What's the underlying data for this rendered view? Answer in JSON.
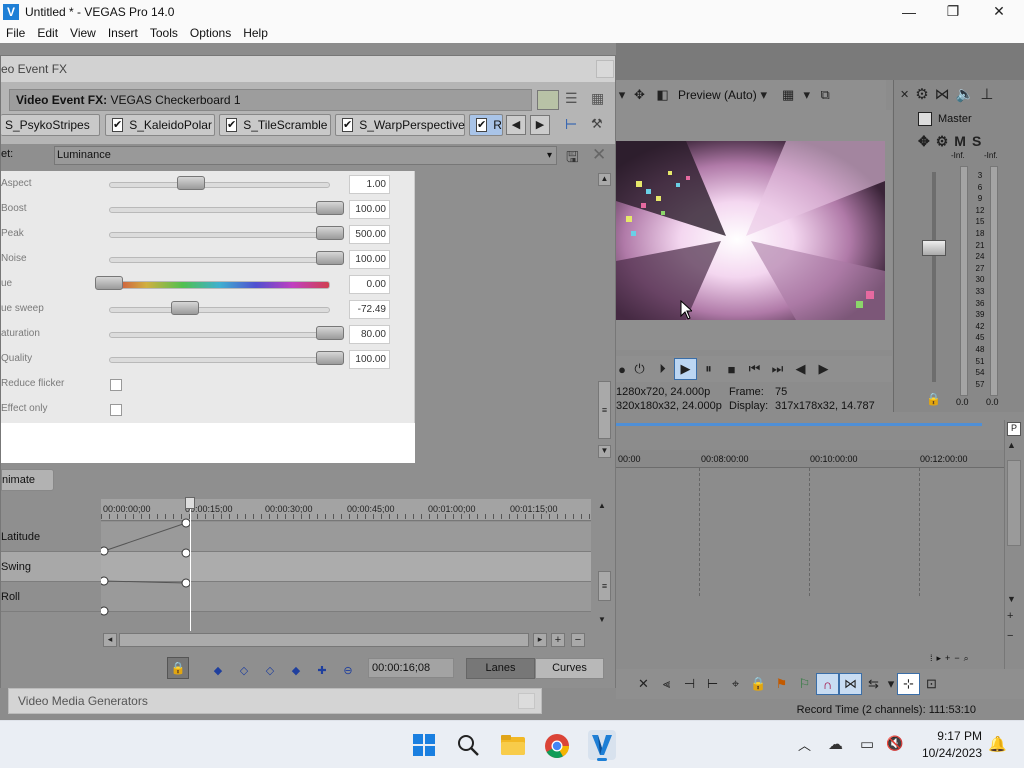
{
  "window": {
    "title": "Untitled * - VEGAS Pro 14.0",
    "logo_letter": "V"
  },
  "window_controls": {
    "minimize": "—",
    "maximize": "❐",
    "close": "✕"
  },
  "menu": [
    "File",
    "Edit",
    "View",
    "Insert",
    "Tools",
    "Options",
    "Help"
  ],
  "fx_dialog": {
    "title": "eo Event FX",
    "header_label": "Video Event FX:",
    "header_value": "VEGAS Checkerboard 1",
    "chain": [
      {
        "label": "S_PsykoStripes",
        "checked": true
      },
      {
        "label": "S_KaleidoPolar",
        "checked": true
      },
      {
        "label": "S_TileScramble",
        "checked": true
      },
      {
        "label": "S_WarpPerspective",
        "checked": true
      },
      {
        "label": "R",
        "checked": true
      }
    ],
    "preset_label": "et:",
    "preset_value": "Luminance",
    "params": [
      {
        "label": "Aspect",
        "value": "1.00",
        "level": 0.33
      },
      {
        "label": "Boost",
        "value": "100.00",
        "level": 1.0
      },
      {
        "label": "Peak",
        "value": "500.00",
        "level": 1.0
      },
      {
        "label": "Noise",
        "value": "100.00",
        "level": 1.0
      },
      {
        "label": "ue",
        "value": "0.00",
        "level": 0.0
      },
      {
        "label": "ue sweep",
        "value": "-72.49",
        "level": 0.3
      },
      {
        "label": "aturation",
        "value": "80.00",
        "level": 1.0
      },
      {
        "label": "Quality",
        "value": "100.00",
        "level": 1.0
      }
    ],
    "checkbox_params": [
      {
        "label": "Reduce flicker",
        "checked": false
      },
      {
        "label": "Effect only",
        "checked": false
      }
    ],
    "animate_label": "nimate",
    "keyframe_ruler": [
      "00:00:00;00",
      "00:00:15;00",
      "00:00:30;00",
      "00:00:45;00",
      "00:01:00;00",
      "00:01:15;00"
    ],
    "keyframe_tracks": [
      "Latitude",
      "Swing",
      "Roll"
    ],
    "time_display": "00:00:16;08",
    "lanes_label": "Lanes",
    "curves_label": "Curves"
  },
  "preview": {
    "mode": "Preview (Auto)",
    "project_label": "1280x720, 24.000p",
    "preview_label": "320x180x32, 24.000p",
    "frame_label": "Frame:",
    "frame_value": "75",
    "display_label": "Display:",
    "display_value": "317x178x32, 14.787"
  },
  "mixer": {
    "master_label": "Master",
    "mute": "M",
    "solo": "S",
    "peak_left": "-Inf.",
    "peak_right": "-Inf.",
    "scale": [
      "3",
      "6",
      "9",
      "12",
      "15",
      "18",
      "21",
      "24",
      "27",
      "30",
      "33",
      "36",
      "39",
      "42",
      "45",
      "48",
      "51",
      "54",
      "57"
    ],
    "level_left": "0.0",
    "level_right": "0.0"
  },
  "timeline": {
    "ruler": [
      "00:00",
      "00:08:00:00",
      "00:10:00:00",
      "00:12:00:00"
    ],
    "record_time": "Record Time (2 channels): 111:53:10"
  },
  "media_generators": {
    "title": "Video Media Generators"
  },
  "taskbar": {
    "time": "9:17 PM",
    "date": "10/24/2023"
  },
  "colors": {
    "accent": "#1e7fd6",
    "playhead": "#ffffff"
  }
}
